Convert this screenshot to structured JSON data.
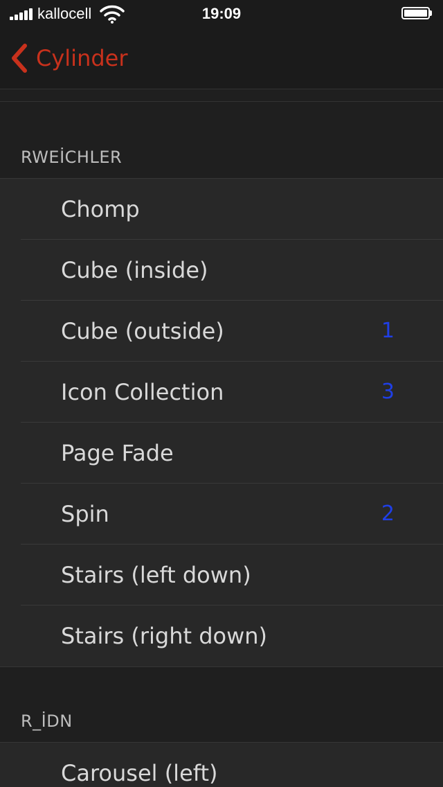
{
  "status_bar": {
    "carrier": "kallocell",
    "time": "19:09"
  },
  "nav": {
    "back_label": "Cylinder"
  },
  "colors": {
    "accent": "#c8311c",
    "badge": "#1f3fe6",
    "background": "#1f1f1f",
    "cell": "#282828"
  },
  "sections": [
    {
      "header": "RWEİCHLER",
      "items": [
        {
          "label": "Chomp",
          "badge": ""
        },
        {
          "label": "Cube (inside)",
          "badge": ""
        },
        {
          "label": "Cube (outside)",
          "badge": "1"
        },
        {
          "label": "Icon Collection",
          "badge": "3"
        },
        {
          "label": "Page Fade",
          "badge": ""
        },
        {
          "label": "Spin",
          "badge": "2"
        },
        {
          "label": "Stairs (left down)",
          "badge": ""
        },
        {
          "label": "Stairs (right down)",
          "badge": ""
        }
      ]
    },
    {
      "header": "R_İDN",
      "items": [
        {
          "label": "Carousel (left)",
          "badge": ""
        }
      ]
    }
  ]
}
